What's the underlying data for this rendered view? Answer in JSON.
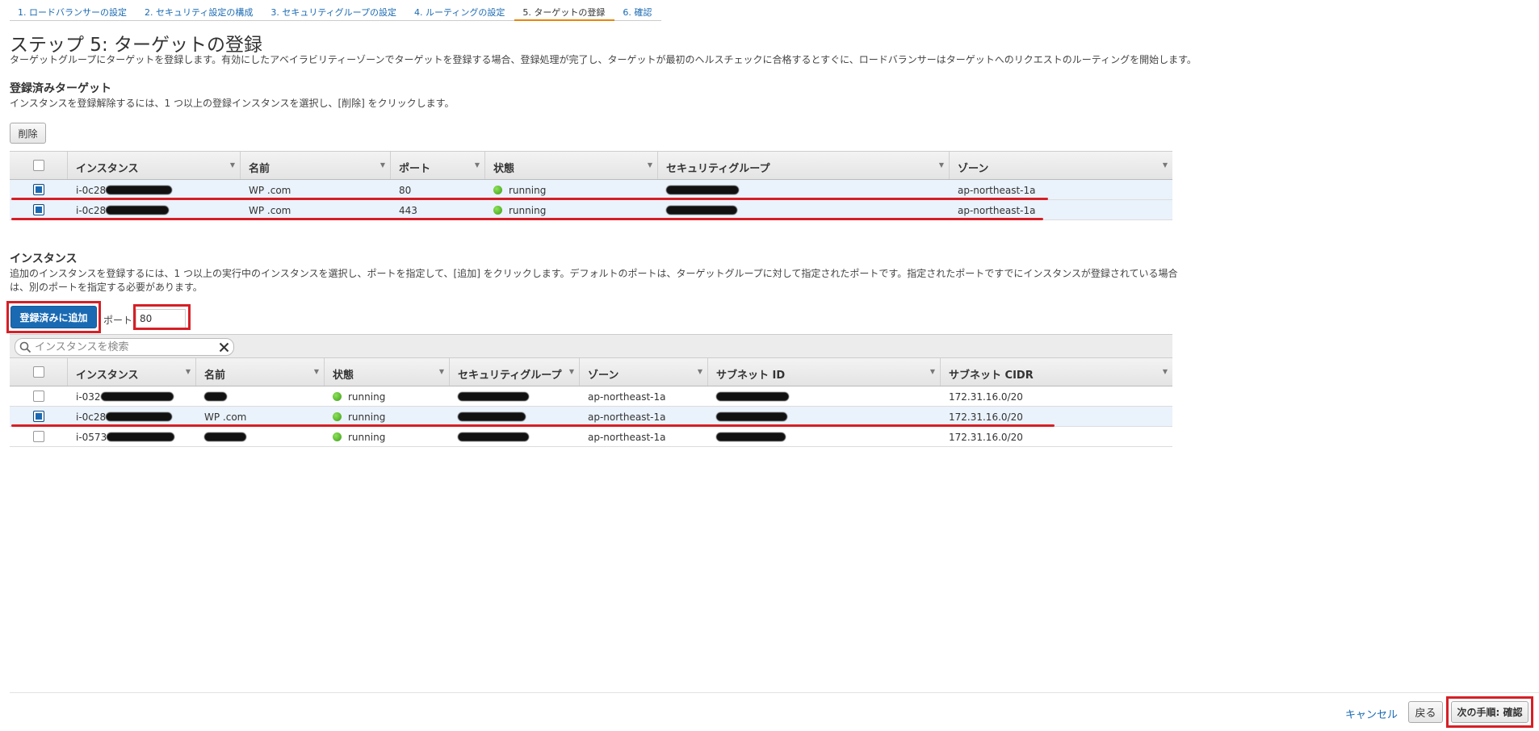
{
  "wizard_steps": [
    "1. ロードバランサーの設定",
    "2. セキュリティ設定の構成",
    "3. セキュリティグループの設定",
    "4. ルーティングの設定",
    "5. ターゲットの登録",
    "6. 確認"
  ],
  "page": {
    "title": "ステップ 5: ターゲットの登録",
    "description": "ターゲットグループにターゲットを登録します。有効にしたアベイラビリティーゾーンでターゲットを登録する場合、登録処理が完了し、ターゲットが最初のヘルスチェックに合格するとすぐに、ロードバランサーはターゲットへのリクエストのルーティングを開始します。"
  },
  "registered": {
    "heading": "登録済みターゲット",
    "instruction": "インスタンスを登録解除するには、1 つ以上の登録インスタンスを選択し、[削除] をクリックします。",
    "remove_label": "削除",
    "columns": [
      "インスタンス",
      "名前",
      "ポート",
      "状態",
      "セキュリティグループ",
      "ゾーン"
    ],
    "rows": [
      {
        "instance": "i-0c28",
        "name": "WP .com",
        "port": "80",
        "state": "running",
        "zone": "ap-northeast-1a",
        "selected": true
      },
      {
        "instance": "i-0c28",
        "name": "WP .com",
        "port": "443",
        "state": "running",
        "zone": "ap-northeast-1a",
        "selected": true
      }
    ]
  },
  "instances": {
    "heading": "インスタンス",
    "instruction": "追加のインスタンスを登録するには、1 つ以上の実行中のインスタンスを選択し、ポートを指定して、[追加] をクリックします。デフォルトのポートは、ターゲットグループに対して指定されたポートです。指定されたポートですでにインスタンスが登録されている場合は、別のポートを指定する必要があります。",
    "add_label": "登録済みに追加",
    "port_label": "ポート",
    "port_value": "80",
    "search_placeholder": "インスタンスを検索",
    "columns": [
      "インスタンス",
      "名前",
      "状態",
      "セキュリティグループ",
      "ゾーン",
      "サブネット ID",
      "サブネット CIDR"
    ],
    "rows": [
      {
        "instance": "i-032",
        "name": "",
        "state": "running",
        "zone": "ap-northeast-1a",
        "cidr": "172.31.16.0/20",
        "selected": false
      },
      {
        "instance": "i-0c28",
        "name": "WP .com",
        "state": "running",
        "zone": "ap-northeast-1a",
        "cidr": "172.31.16.0/20",
        "selected": true
      },
      {
        "instance": "i-0573",
        "name": "",
        "state": "running",
        "zone": "ap-northeast-1a",
        "cidr": "172.31.16.0/20",
        "selected": false
      }
    ]
  },
  "footer": {
    "cancel_label": "キャンセル",
    "back_label": "戻る",
    "next_label": "次の手順: 確認"
  },
  "colors": {
    "accent_blue": "#1a6ab3",
    "annotation_red": "#d61f26",
    "active_tab_orange": "#e7850a",
    "running_green": "#3c9e16"
  }
}
